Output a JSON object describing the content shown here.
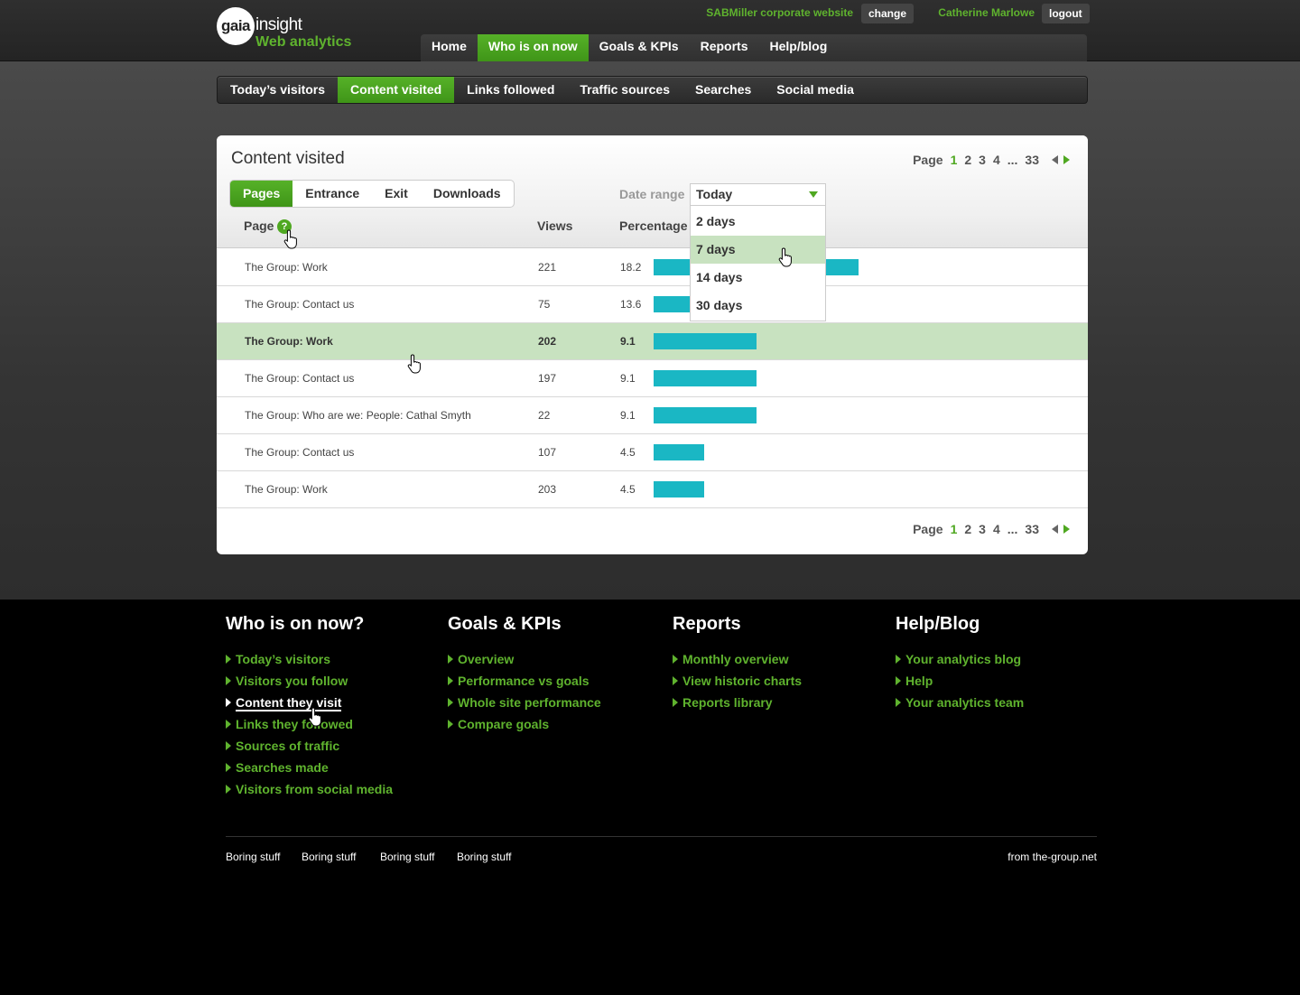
{
  "brand": {
    "logo_word": "gaia",
    "logo_insight": "insight",
    "logo_sub": "Web analytics"
  },
  "header": {
    "site_name": "SABMiller corporate website",
    "change_label": "change",
    "user_name": "Catherine Marlowe",
    "logout_label": "logout"
  },
  "main_nav": [
    {
      "label": "Home",
      "active": false
    },
    {
      "label": "Who is on now",
      "active": true
    },
    {
      "label": "Goals & KPIs",
      "active": false
    },
    {
      "label": "Reports",
      "active": false
    },
    {
      "label": "Help/blog",
      "active": false
    }
  ],
  "sub_nav": [
    {
      "label": "Today’s visitors",
      "active": false
    },
    {
      "label": "Content visited",
      "active": true
    },
    {
      "label": "Links followed",
      "active": false
    },
    {
      "label": "Traffic sources",
      "active": false
    },
    {
      "label": "Searches",
      "active": false
    },
    {
      "label": "Social media",
      "active": false
    }
  ],
  "panel": {
    "title": "Content visited",
    "pager": {
      "label": "Page",
      "current": "1",
      "pages": [
        "2",
        "3",
        "4",
        "...",
        "33"
      ]
    },
    "segments": [
      {
        "label": "Pages",
        "active": true
      },
      {
        "label": "Entrance",
        "active": false
      },
      {
        "label": "Exit",
        "active": false
      },
      {
        "label": "Downloads",
        "active": false
      }
    ],
    "date_range": {
      "label": "Date range",
      "selected": "Today",
      "options": [
        "2 days",
        "7 days",
        "14 days",
        "30 days"
      ],
      "highlighted": "7 days"
    },
    "columns": {
      "page": "Page",
      "views": "Views",
      "percentage": "Percentage",
      "help_icon": "?"
    },
    "rows": [
      {
        "page": "The Group: Work",
        "views": "221",
        "pct": "18.2",
        "bar_fraction": 1.0,
        "highlight": false
      },
      {
        "page": "The Group: Contact us",
        "views": "75",
        "pct": "13.6",
        "bar_fraction": 0.747,
        "highlight": false
      },
      {
        "page": "The Group: Work",
        "views": "202",
        "pct": "9.1",
        "bar_fraction": 0.5,
        "highlight": true
      },
      {
        "page": "The Group: Contact us",
        "views": "197",
        "pct": "9.1",
        "bar_fraction": 0.5,
        "highlight": false
      },
      {
        "page": "The Group: Who are we: People: Cathal Smyth",
        "views": "22",
        "pct": "9.1",
        "bar_fraction": 0.5,
        "highlight": false
      },
      {
        "page": "The Group: Contact us",
        "views": "107",
        "pct": "4.5",
        "bar_fraction": 0.247,
        "highlight": false
      },
      {
        "page": "The Group: Work",
        "views": "203",
        "pct": "4.5",
        "bar_fraction": 0.247,
        "highlight": false
      }
    ],
    "bar_color": "#1ab7c4"
  },
  "footer": {
    "columns": [
      {
        "title": "Who is on now?",
        "links": [
          "Today’s visitors",
          "Visitors you follow",
          "Content they visit",
          "Links they followed",
          "Sources of traffic",
          "Searches made",
          "Visitors from social media"
        ],
        "current": "Content they visit"
      },
      {
        "title": "Goals & KPIs",
        "links": [
          "Overview",
          "Performance vs goals",
          "Whole site performance",
          "Compare goals"
        ]
      },
      {
        "title": "Reports",
        "links": [
          "Monthly overview",
          "View historic charts",
          "Reports library"
        ]
      },
      {
        "title": "Help/Blog",
        "links": [
          "Your analytics blog",
          "Help",
          "Your analytics team"
        ]
      }
    ],
    "boring": [
      "Boring stuff",
      "Boring stuff",
      "Boring stuff",
      "Boring stuff"
    ],
    "credit": "from the-group.net"
  },
  "colors": {
    "accent_green": "#4fa821",
    "link_green": "#5fb32e",
    "highlight_row": "#c8e2c0"
  },
  "icons": [
    "hand-cursor-icon",
    "help-icon",
    "dropdown-arrow-icon",
    "prev-page-icon",
    "next-page-icon",
    "bullet-arrow-icon"
  ]
}
